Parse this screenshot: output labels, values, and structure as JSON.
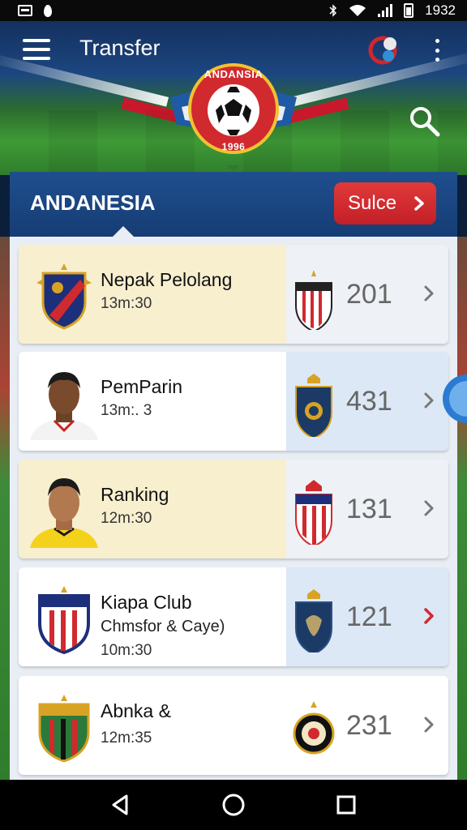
{
  "status_bar": {
    "time": "1932"
  },
  "app_bar": {
    "title": "Transfer"
  },
  "crest": {
    "top_text": "ANDANSIA",
    "year": "1996"
  },
  "region": {
    "name": "ANDANESIA",
    "select_label": "Sulce"
  },
  "matches": [
    {
      "title": "Nepak Pelolang",
      "subtitle": "",
      "time": "13m:30",
      "score": "201",
      "theme": "cream"
    },
    {
      "title": "PemParin",
      "subtitle": "",
      "time": "13m:. 3",
      "score": "431",
      "theme": "blue"
    },
    {
      "title": "Ranking",
      "subtitle": "",
      "time": "12m:30",
      "score": "131",
      "theme": "cream"
    },
    {
      "title": "Kiapa Club",
      "subtitle": "Chmsfor & Caye)",
      "time": "10m:30",
      "score": "121",
      "theme": "blue"
    },
    {
      "title": "Abnka &",
      "subtitle": "",
      "time": "12m:35",
      "score": "231",
      "theme": "white"
    }
  ],
  "colors": {
    "accent_red": "#d02a2f",
    "header_blue": "#1f4e8e",
    "pitch_green": "#3f9a36",
    "card_cream": "#f8efcf",
    "card_blue": "#dce8f6"
  },
  "icons": [
    "menu-icon",
    "globe-icon",
    "more-icon",
    "search-icon",
    "chevron-right-icon",
    "back-icon",
    "home-icon",
    "recents-icon",
    "wifi-icon",
    "signal-icon",
    "battery-icon",
    "bluetooth-icon"
  ]
}
